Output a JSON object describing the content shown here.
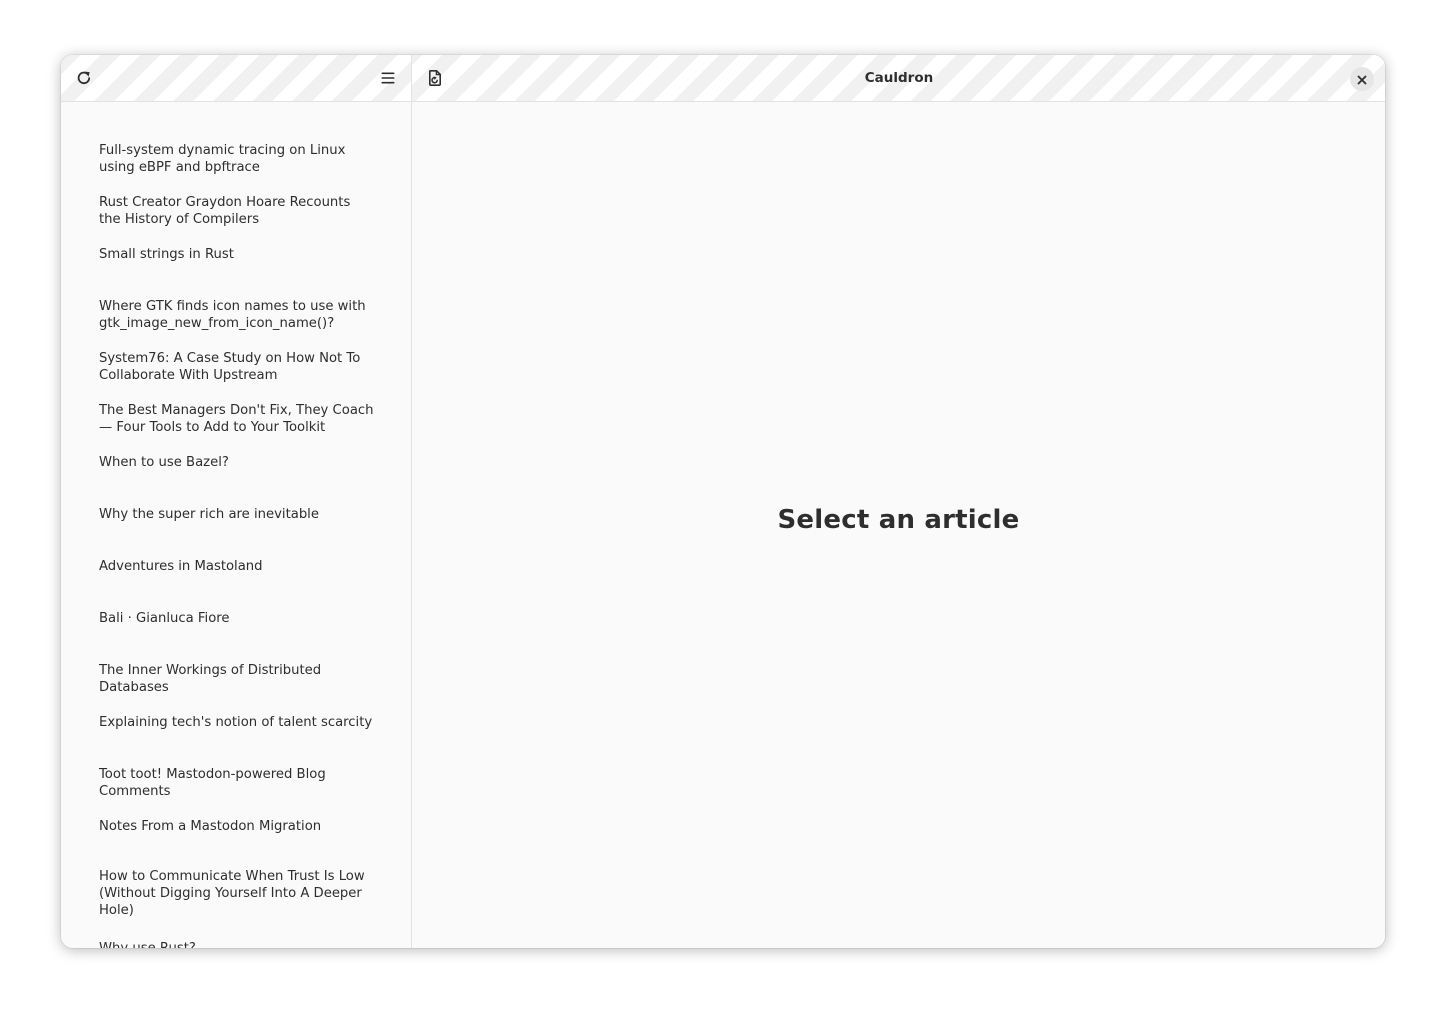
{
  "window": {
    "title": "Cauldron"
  },
  "sidebar": {
    "refresh_icon": "refresh-icon",
    "menu_icon": "hamburger-menu-icon",
    "articles": [
      "Full-system dynamic tracing on Linux using eBPF and bpftrace",
      "Rust Creator Graydon Hoare Recounts the History of Compilers",
      "Small strings in Rust",
      "Where GTK finds icon names to use with gtk_image_new_from_icon_name()?",
      "System76: A Case Study on How Not To Collaborate With Upstream",
      "The Best Managers Don't Fix, They Coach — Four Tools to Add to Your Toolkit",
      "When to use Bazel?",
      "Why the super rich are inevitable",
      "Adventures in Mastoland",
      "Bali · Gianluca Fiore",
      "The Inner Workings of Distributed Databases",
      "Explaining tech's notion of talent scarcity",
      "Toot toot! Mastodon-powered Blog Comments",
      "Notes From a Mastodon Migration",
      "How to Communicate When Trust Is Low (Without Digging Yourself Into A Deeper Hole)",
      "Why use Rust?"
    ]
  },
  "content": {
    "open_icon": "document-open-icon",
    "close_icon": "close-icon",
    "placeholder": "Select an article"
  },
  "colors": {
    "background": "#fafafa",
    "text": "#2e2e2e",
    "border": "#e2e2e2"
  }
}
